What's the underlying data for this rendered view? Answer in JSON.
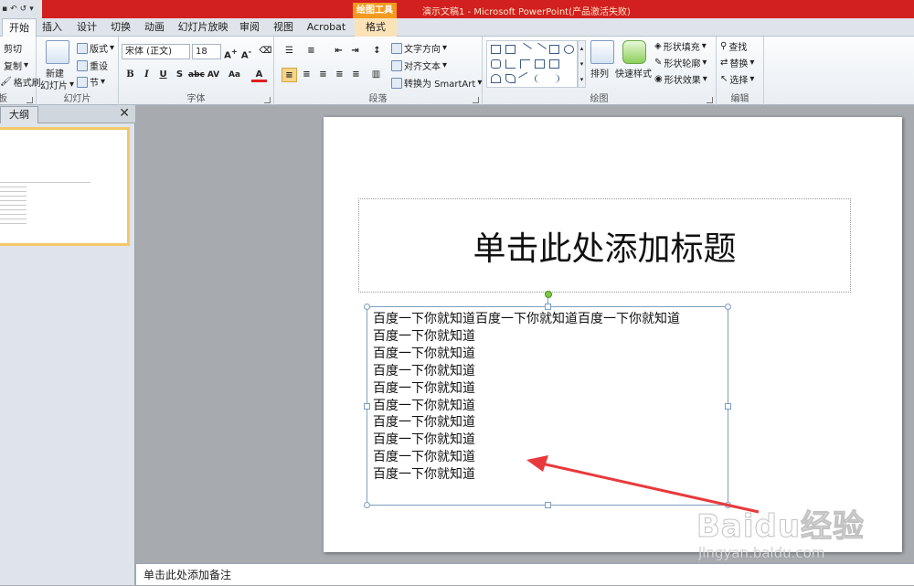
{
  "window": {
    "title": "演示文稿1 - Microsoft PowerPoint(产品激活失败)",
    "context_group": "绘图工具"
  },
  "tabs": [
    "开始",
    "插入",
    "设计",
    "切换",
    "动画",
    "幻灯片放映",
    "审阅",
    "视图",
    "Acrobat",
    "格式"
  ],
  "active_tab": "开始",
  "ribbon": {
    "clipboard": {
      "cut": "剪切",
      "copy": "复制",
      "format_painter": "格式刷",
      "label": "板"
    },
    "slides": {
      "new_slide_line1": "新建",
      "new_slide_line2": "幻灯片",
      "layout": "版式",
      "reset": "重设",
      "section": "节",
      "label": "幻灯片"
    },
    "font": {
      "font_name": "宋体 (正文)",
      "font_size": "18",
      "label": "字体"
    },
    "paragraph": {
      "text_direction": "文字方向",
      "align_text": "对齐文本",
      "smartart": "转换为 SmartArt",
      "label": "段落"
    },
    "drawing": {
      "arrange": "排列",
      "quick_styles": "快速样式",
      "shape_fill": "形状填充",
      "shape_outline": "形状轮廓",
      "shape_effects": "形状效果",
      "label": "绘图"
    },
    "editing": {
      "find": "查找",
      "replace": "替换",
      "select": "选择",
      "label": "编辑"
    }
  },
  "left_panel": {
    "outline_tab": "大纲",
    "close": "✕"
  },
  "slide": {
    "title_placeholder": "单击此处添加标题",
    "content_lines": [
      "百度一下你就知道百度一下你就知道百度一下你就知道",
      "百度一下你就知道",
      "百度一下你就知道",
      "百度一下你就知道",
      "百度一下你就知道",
      "百度一下你就知道",
      "百度一下你就知道",
      "百度一下你就知道",
      "百度一下你就知道",
      "百度一下你就知道"
    ]
  },
  "notes": {
    "placeholder": "单击此处添加备注"
  },
  "watermark": {
    "brand": "Baidu经验",
    "url": "jingyan.baidu.com"
  },
  "colors": {
    "titlebar": "#d21f1f",
    "context_tab": "#f39a1e",
    "annotation_arrow": "#e8393c"
  }
}
